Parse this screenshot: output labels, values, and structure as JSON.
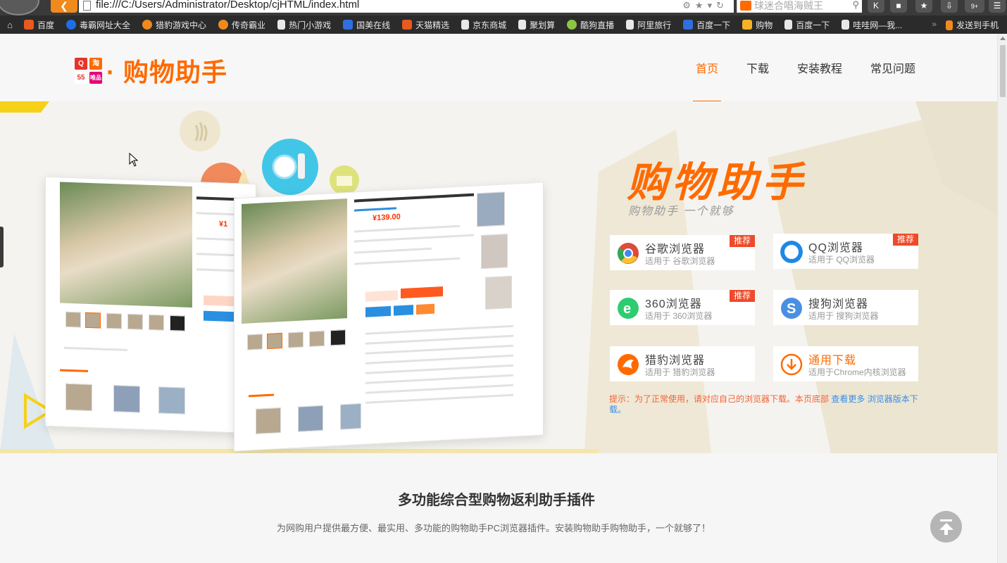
{
  "browser": {
    "url": "file:///C:/Users/Administrator/Desktop/cjHTML/index.html",
    "search_placeholder": "球迷合唱海贼王",
    "toolbar_badge": "9+",
    "bookmarks": [
      {
        "label": "百度",
        "icon": "baidu-icon",
        "color": "#e85a1f"
      },
      {
        "label": "毒霸网址大全",
        "icon": "duba-icon",
        "color": "#1f6ee8"
      },
      {
        "label": "猎豹游戏中心",
        "icon": "liebao-game-icon",
        "color": "#f08a1c"
      },
      {
        "label": "传奇霸业",
        "icon": "chuanqi-icon",
        "color": "#f08a1c"
      },
      {
        "label": "热门小游戏",
        "icon": "page-icon",
        "color": "#e8e8e8"
      },
      {
        "label": "国美在线",
        "icon": "paw-icon",
        "color": "#2f6fe0"
      },
      {
        "label": "天猫精选",
        "icon": "tmall-icon",
        "color": "#e85a1f"
      },
      {
        "label": "京东商城",
        "icon": "page-icon",
        "color": "#e8e8e8"
      },
      {
        "label": "聚划算",
        "icon": "page-icon",
        "color": "#e8e8e8"
      },
      {
        "label": "酷狗直播",
        "icon": "kugou-icon",
        "color": "#8dc63f"
      },
      {
        "label": "阿里旅行",
        "icon": "page-icon",
        "color": "#e8e8e8"
      },
      {
        "label": "百度一下",
        "icon": "paw-icon",
        "color": "#2f6fe0"
      },
      {
        "label": "购物",
        "icon": "folder-icon",
        "color": "#f5b324"
      },
      {
        "label": "百度一下",
        "icon": "page-icon",
        "color": "#e8e8e8"
      },
      {
        "label": "哇哇网—我...",
        "icon": "page-icon",
        "color": "#e8e8e8"
      }
    ],
    "bookmark_more": "»",
    "send_to_phone": "发送到手机"
  },
  "header": {
    "logo_text": "· 购物助手",
    "logo_tiles": [
      "Q",
      "淘",
      "55",
      "唯品"
    ],
    "nav": [
      {
        "label": "首页",
        "active": true
      },
      {
        "label": "下载",
        "active": false
      },
      {
        "label": "安装教程",
        "active": false
      },
      {
        "label": "常见问题",
        "active": false
      }
    ]
  },
  "hero": {
    "title": "购物助手",
    "subtitle": "购物助手 一个就够",
    "mockup_price": "¥139.00",
    "browsers": [
      {
        "name": "谷歌浏览器",
        "desc": "适用于 谷歌浏览器",
        "badge": "推荐",
        "icon": "chrome-icon",
        "color": "#dd4b39"
      },
      {
        "name": "QQ浏览器",
        "desc": "适用于 QQ浏览器",
        "badge": "推荐",
        "icon": "qq-browser-icon",
        "color": "#1e88e5"
      },
      {
        "name": "360浏览器",
        "desc": "适用于 360浏览器",
        "badge": "推荐",
        "icon": "360-browser-icon",
        "color": "#2ecc71"
      },
      {
        "name": "搜狗浏览器",
        "desc": "适用于 搜狗浏览器",
        "badge": "",
        "icon": "sogou-browser-icon",
        "color": "#4a90e2"
      },
      {
        "name": "猎豹浏览器",
        "desc": "适用于 猎豹浏览器",
        "badge": "",
        "icon": "liebao-browser-icon",
        "color": "#ff6a00"
      },
      {
        "name": "通用下载",
        "desc": "适用于Chrome内核浏览器",
        "badge": "",
        "icon": "download-icon",
        "color": "#ff6a00"
      }
    ],
    "tip_prefix": "提示：为了正常使用，请对应自己的浏览器下载。本页底部",
    "tip_link": "查看更多",
    "tip_suffix": "浏览器版本下载。"
  },
  "intro": {
    "title": "多功能综合型购物返利助手插件",
    "desc": "为网购用户提供最方便、最实用、多功能的购物助手PC浏览器插件。安装购物助手购物助手，一个就够了！"
  }
}
